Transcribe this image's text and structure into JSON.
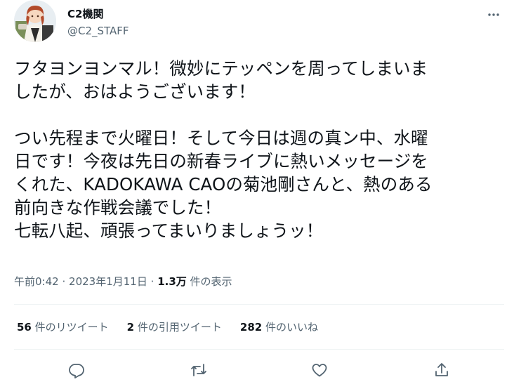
{
  "author": {
    "display_name": "C2機関",
    "handle": "@C2_STAFF",
    "avatar": "anime-character-avatar"
  },
  "tweet": {
    "text": "フタヨンヨンマル！微妙にテッペンを周ってしまいま\nしたが、おはようございます！\n\nつい先程まで火曜日！そして今日は週の真ン中、水曜\n日です！今夜は先日の新春ライブに熱いメッセージを\nくれた、KADOKAWA CAOの菊池剛さんと、熱のある\n前向きな作戦会議でした！\n七転八起、頑張ってまいりましょうッ！",
    "time": "午前0:42",
    "separator": "·",
    "date": "2023年1月11日",
    "views_count": "1.3万",
    "views_label": "件の表示"
  },
  "stats": {
    "retweets_count": "56",
    "retweets_label": "件のリツイート",
    "quotes_count": "2",
    "quotes_label": "件の引用ツイート",
    "likes_count": "282",
    "likes_label": "件のいいね"
  },
  "icons": {
    "more": "more-icon",
    "reply": "reply-icon",
    "retweet": "retweet-icon",
    "like": "heart-icon",
    "share": "share-icon"
  },
  "colors": {
    "text": "#0f1419",
    "secondary": "#536471",
    "divider": "#eff3f4"
  }
}
